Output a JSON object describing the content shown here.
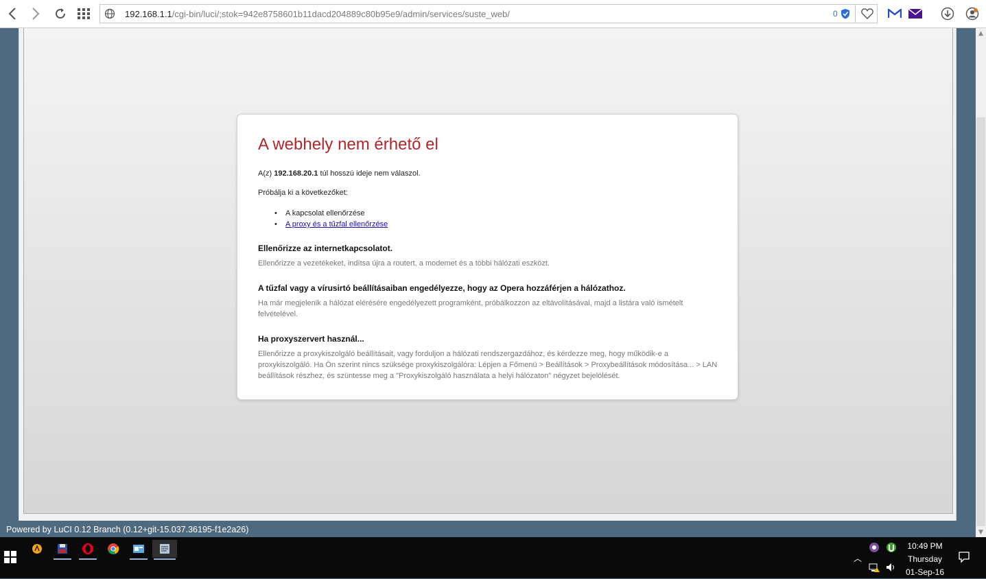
{
  "browser": {
    "url_host": "192.168.1.1",
    "url_rest": "/cgi-bin/luci/;stok=942e8758601b11dacd204889c80b95e9/admin/services/suste_web/",
    "blocked_count": "0"
  },
  "error_page": {
    "title": "A webhely nem érhető el",
    "line1_prefix": "A(z) ",
    "line1_host": "192.168.20.1",
    "line1_suffix": " túl hosszú ideje nem válaszol.",
    "try_label": "Próbálja ki a következőket:",
    "suggestions": [
      "A kapcsolat ellenőrzése",
      "A proxy és a tűzfal ellenőrzése"
    ],
    "sections": [
      {
        "heading": "Ellenőrizze az internetkapcsolatot.",
        "text": "Ellenőrizze a vezetékeket, indítsa újra a routert, a modemet és a többi hálózati eszközt."
      },
      {
        "heading": "A tűzfal vagy a vírusirtó beállításaiban engedélyezze, hogy az Opera hozzáférjen a hálózathoz.",
        "text": "Ha már megjelenik a hálózat elérésére engedélyezett programként, próbálkozzon az eltávolításával, majd a listára való ismételt felvételével."
      },
      {
        "heading": "Ha proxyszervert használ...",
        "text": "Ellenőrizze a proxykiszolgáló beállításait, vagy forduljon a hálózati rendszergazdához, és kérdezze meg, hogy működik-e a proxykiszolgáló. Ha Ön szerint nincs szüksége proxykiszolgálóra: Lépjen a Főmenü > Beállítások > Proxybeállítások módosítása... > LAN beállítások részhez, és szüntesse meg a \"Proxykiszolgáló használata a helyi hálózaton\" négyzet bejelölését."
      }
    ]
  },
  "footer": {
    "luci": "Powered by LuCI 0.12 Branch (0.12+git-15.037.36195-f1e2a26)"
  },
  "taskbar": {
    "time": "10:49 PM",
    "day": "Thursday",
    "date": "01-Sep-16"
  },
  "colors": {
    "title_red": "#b3262a",
    "link": "#1a0dab",
    "desktop": "#4e6a80"
  }
}
